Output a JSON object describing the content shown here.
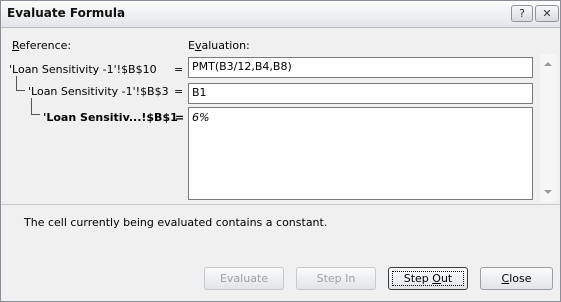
{
  "window": {
    "title": "Evaluate Formula",
    "help_glyph": "?",
    "close_glyph": "✕"
  },
  "labels": {
    "reference_prefix": "R",
    "reference_rest": "eference:",
    "evaluation_prefix": "E",
    "evaluation_v": "v",
    "evaluation_rest": "aluation:"
  },
  "rows": [
    {
      "reference": "'Loan Sensitivity -1'!$B$10",
      "equals": "=",
      "evaluation": "PMT(B3/12,B4,B8)"
    },
    {
      "reference": "'Loan Sensitivity -1'!$B$3",
      "equals": "=",
      "evaluation": "B1"
    },
    {
      "reference": "'Loan Sensitiv...!$B$1",
      "equals": "=",
      "evaluation": "6%"
    }
  ],
  "status_text": "The cell currently being evaluated contains a constant.",
  "buttons": {
    "evaluate": "Evaluate",
    "step_in": "Step In",
    "step_out_prefix": "Step ",
    "step_out_key": "O",
    "step_out_rest": "ut",
    "close_key": "C",
    "close_rest": "lose"
  },
  "state": {
    "evaluate_enabled": false,
    "step_in_enabled": false,
    "step_out_enabled": true,
    "close_enabled": true
  }
}
